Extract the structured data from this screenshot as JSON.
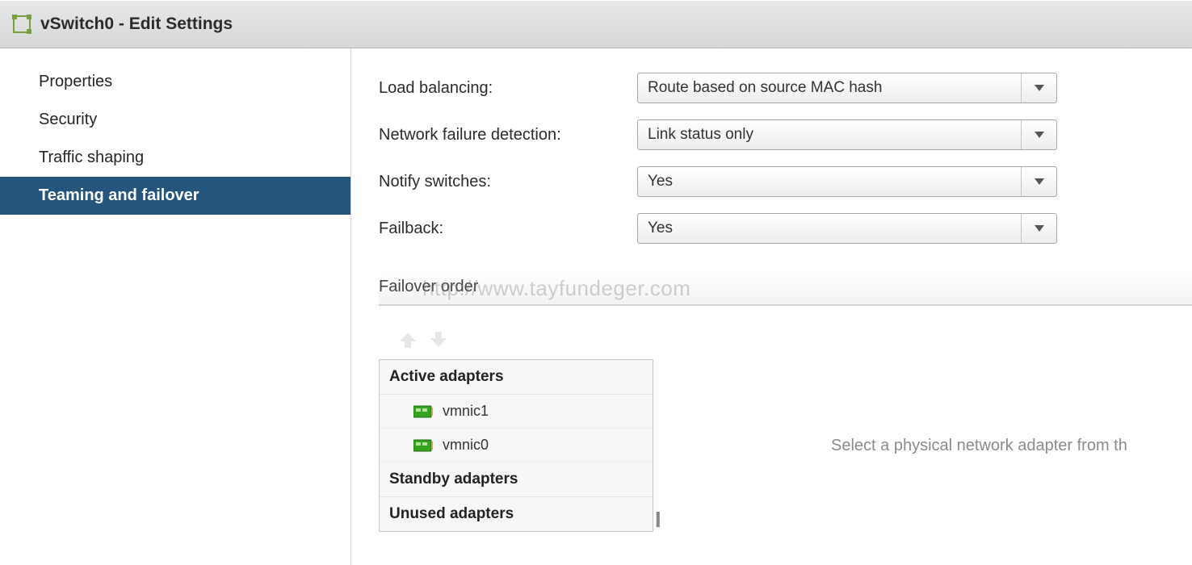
{
  "titlebar": {
    "title": "vSwitch0 - Edit Settings"
  },
  "sidebar": {
    "items": [
      {
        "label": "Properties"
      },
      {
        "label": "Security"
      },
      {
        "label": "Traffic shaping"
      },
      {
        "label": "Teaming and failover"
      }
    ]
  },
  "settings": {
    "load_balancing_label": "Load balancing:",
    "load_balancing_value": "Route based on source MAC hash",
    "failure_detection_label": "Network failure detection:",
    "failure_detection_value": "Link status only",
    "notify_switches_label": "Notify switches:",
    "notify_switches_value": "Yes",
    "failback_label": "Failback:",
    "failback_value": "Yes"
  },
  "failover": {
    "section_title": "Failover order",
    "groups": {
      "active_label": "Active adapters",
      "active_items": [
        {
          "name": "vmnic1"
        },
        {
          "name": "vmnic0"
        }
      ],
      "standby_label": "Standby adapters",
      "unused_label": "Unused adapters"
    },
    "hint_text": "Select a physical network adapter from th"
  },
  "watermark": "http://www.tayfundeger.com"
}
